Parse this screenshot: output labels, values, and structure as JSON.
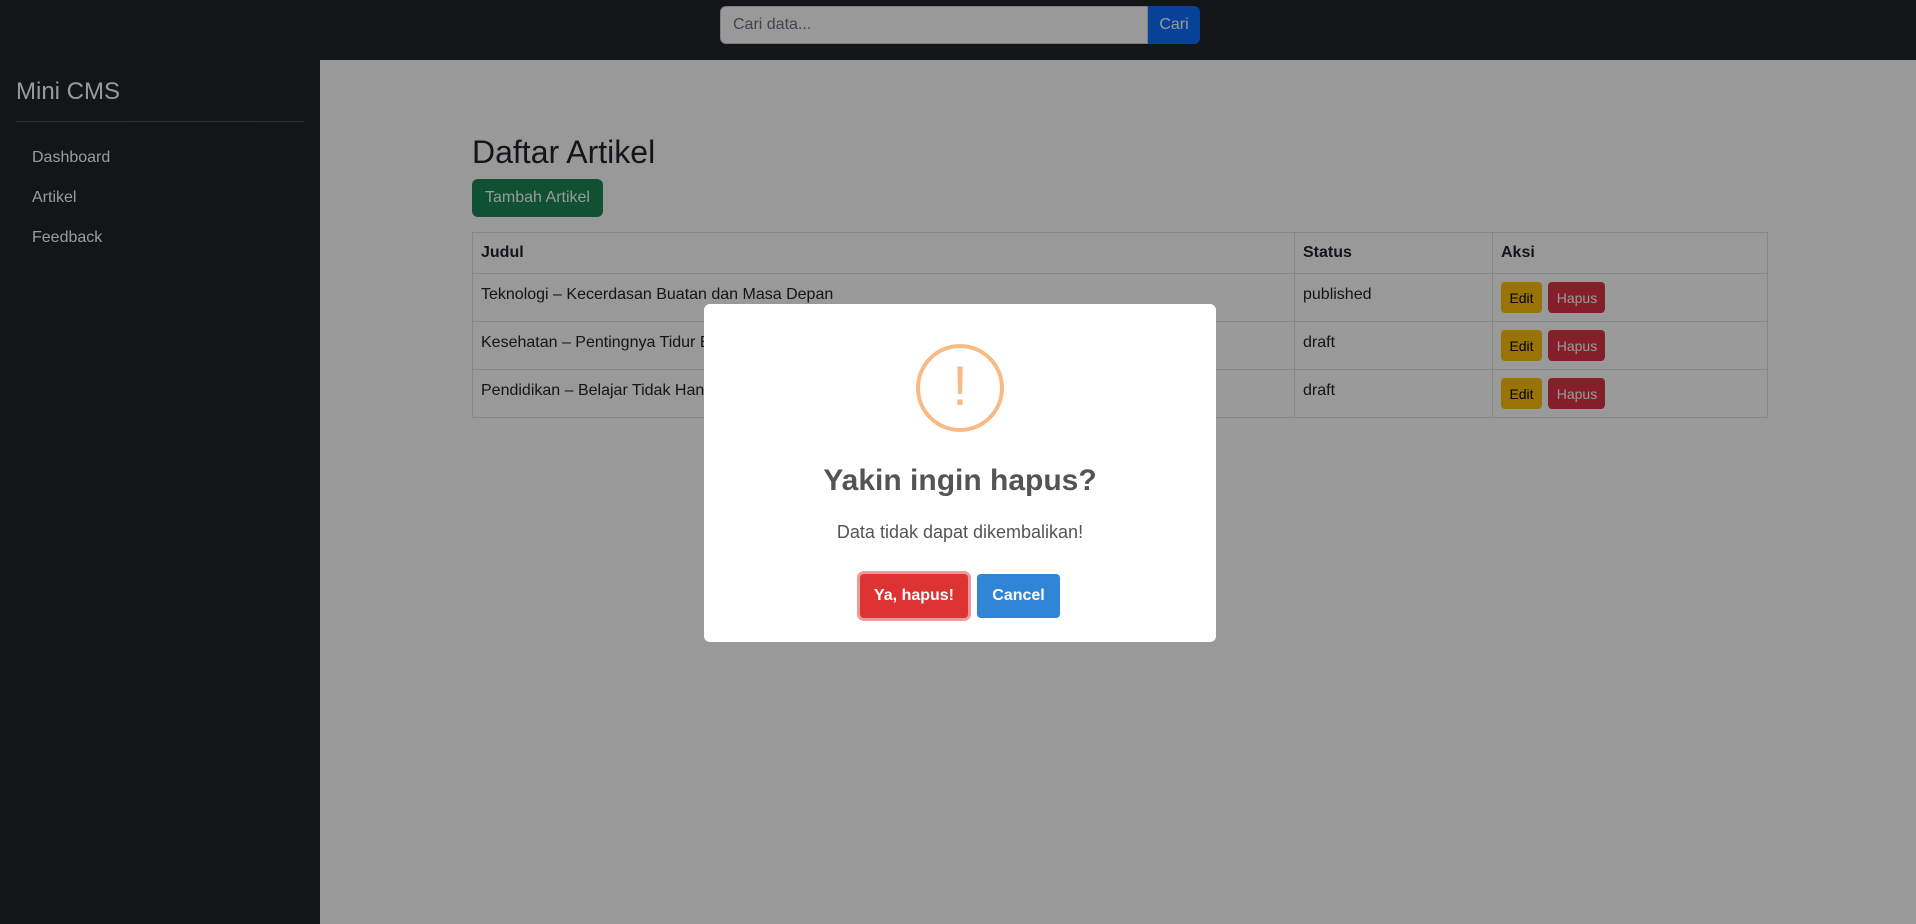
{
  "topbar": {
    "search_placeholder": "Cari data...",
    "search_button": "Cari"
  },
  "sidebar": {
    "brand": "Mini CMS",
    "items": [
      {
        "label": "Dashboard"
      },
      {
        "label": "Artikel"
      },
      {
        "label": "Feedback"
      }
    ]
  },
  "main": {
    "title": "Daftar Artikel",
    "add_button": "Tambah Artikel",
    "table": {
      "headers": [
        "Judul",
        "Status",
        "Aksi"
      ],
      "rows": [
        {
          "title": "Teknologi – Kecerdasan Buatan dan Masa Depan",
          "status": "published"
        },
        {
          "title": "Kesehatan – Pentingnya Tidur B",
          "status": "draft"
        },
        {
          "title": "Pendidikan – Belajar Tidak Hany",
          "status": "draft"
        }
      ],
      "edit_label": "Edit",
      "delete_label": "Hapus"
    }
  },
  "dialog": {
    "icon": "warning-icon",
    "icon_glyph": "!",
    "title": "Yakin ingin hapus?",
    "text": "Data tidak dapat dikembalikan!",
    "confirm_button": "Ya, hapus!",
    "cancel_button": "Cancel"
  },
  "colors": {
    "dark": "#212529",
    "primary": "#0d6efd",
    "success": "#198754",
    "warning": "#ffc107",
    "danger": "#dc3545",
    "swal_warning": "#f8bb86",
    "swal_confirm": "#dd3333",
    "swal_cancel": "#3085d6"
  }
}
